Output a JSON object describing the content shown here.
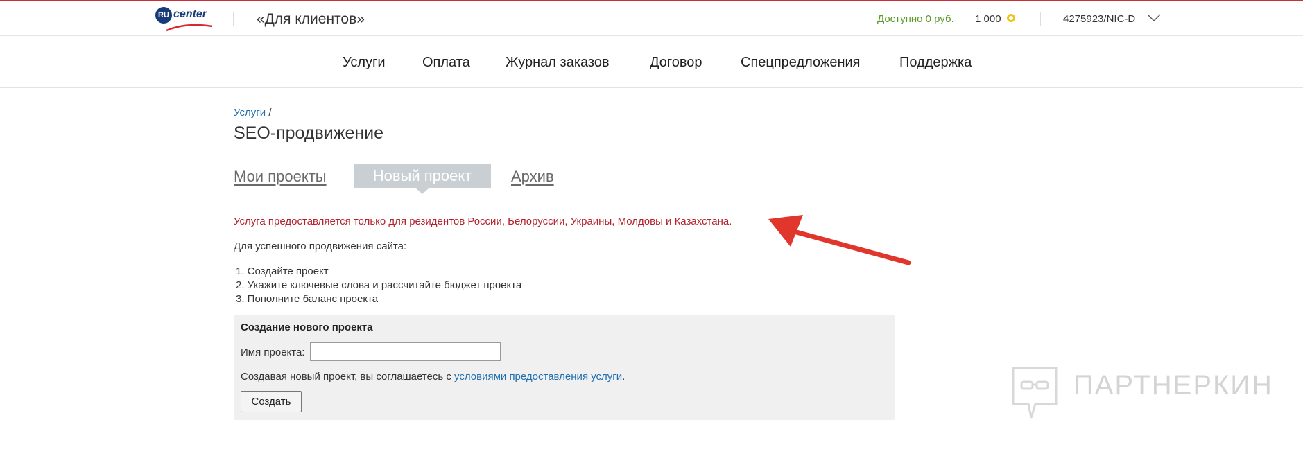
{
  "brand": {
    "logo_badge": "RU",
    "logo_text": "center"
  },
  "header": {
    "section_title": "«Для клиентов»",
    "available": "Доступно 0 руб.",
    "coins": "1 000",
    "account": "4275923/NIC-D"
  },
  "nav": {
    "items": [
      {
        "label": "Услуги"
      },
      {
        "label": "Оплата"
      },
      {
        "label": "Журнал заказов"
      },
      {
        "label": "Договор"
      },
      {
        "label": "Спецпредложения"
      },
      {
        "label": "Поддержка"
      }
    ]
  },
  "breadcrumb": {
    "link": "Услуги",
    "separator": "/"
  },
  "page": {
    "title": "SEO-продвижение"
  },
  "tabs": [
    {
      "label": "Мои проекты",
      "active": false
    },
    {
      "label": "Новый проект",
      "active": true
    },
    {
      "label": "Архив",
      "active": false
    }
  ],
  "notice": "Услуга предоставляется только для резидентов России, Белоруссии, Украины, Молдовы и Казахстана.",
  "intro": "Для успешного продвижения сайта:",
  "steps": [
    "1. Создайте проект",
    "2. Укажите ключевые слова и рассчитайте бюджет проекта",
    "3. Пополните баланс проекта"
  ],
  "form": {
    "title": "Создание нового проекта",
    "name_label": "Имя проекта:",
    "name_value": "",
    "agree_prefix": "Создавая новый проект, вы соглашаетесь с ",
    "agree_link": "условиями предоставления услуги",
    "agree_suffix": ".",
    "submit_label": "Создать"
  },
  "watermark": {
    "text": "ПАРТНЕРКИН"
  },
  "colors": {
    "top_line": "#c8303a",
    "link": "#1f6fb0",
    "warning": "#b3222b",
    "available": "#5a9a26",
    "arrow": "#e0362c",
    "coin": "#f0c419"
  }
}
